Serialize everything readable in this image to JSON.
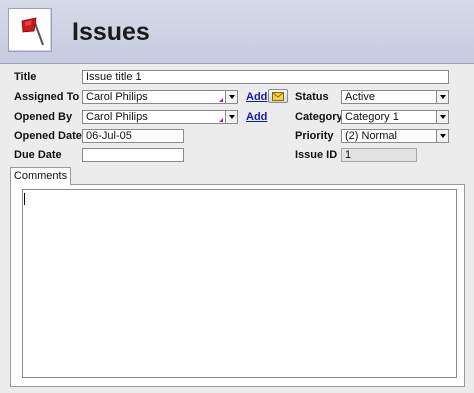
{
  "header": {
    "title": "Issues",
    "logo_icon": "red-flag-icon"
  },
  "form": {
    "title_label": "Title",
    "title_value": "Issue title 1",
    "assigned_label": "Assigned To",
    "assigned_value": "Carol Philips",
    "opened_by_label": "Opened By",
    "opened_by_value": "Carol Philips",
    "opened_date_label": "Opened Date",
    "opened_date_value": "06-Jul-05",
    "due_date_label": "Due Date",
    "due_date_value": "",
    "add_link": "Add",
    "status_label": "Status",
    "status_value": "Active",
    "category_label": "Category",
    "category_value": "Category 1",
    "priority_label": "Priority",
    "priority_value": "(2) Normal",
    "issue_id_label": "Issue ID",
    "issue_id_value": "1"
  },
  "tabs": {
    "comments_label": "Comments"
  },
  "comments": {
    "value": ""
  }
}
